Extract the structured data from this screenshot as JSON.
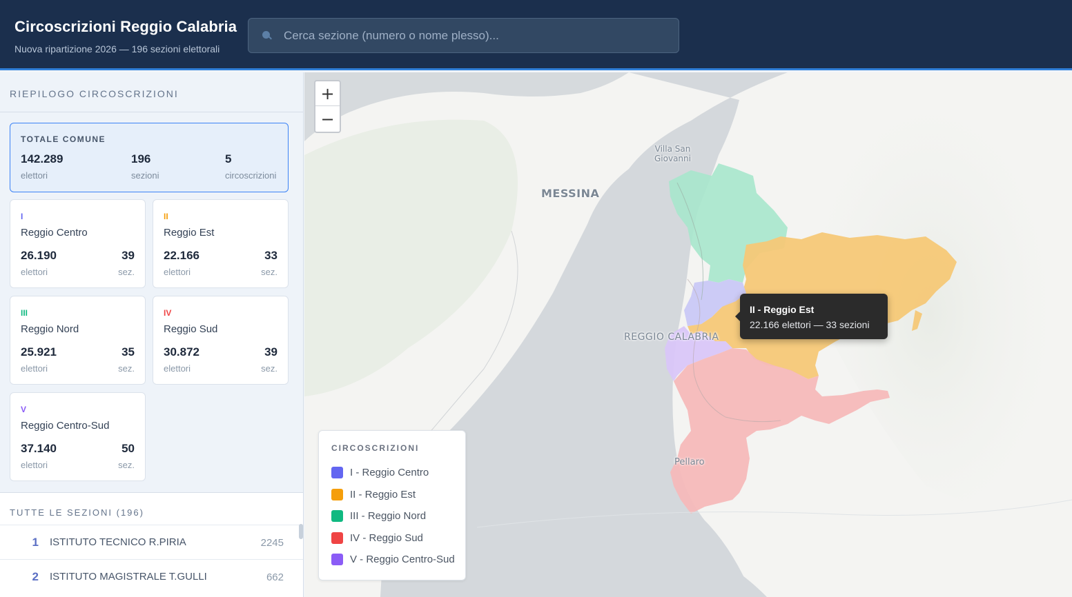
{
  "header": {
    "title": "Circoscrizioni Reggio Calabria",
    "subtitle": "Nuova ripartizione 2026 — 196 sezioni elettorali",
    "search_placeholder": "Cerca sezione (numero o nome plesso)..."
  },
  "sidebar": {
    "summary_heading": "RIEPILOGO CIRCOSCRIZIONI",
    "total": {
      "label": "TOTALE COMUNE",
      "elettori": "142.289",
      "elettori_label": "elettori",
      "sezioni": "196",
      "sezioni_label": "sezioni",
      "circoscrizioni": "5",
      "circoscrizioni_label": "circoscrizioni"
    },
    "circoscrizioni": [
      {
        "roman": "I",
        "name": "Reggio Centro",
        "elettori": "26.190",
        "sezioni": "39",
        "elettori_label": "elettori",
        "sez_label": "sez.",
        "color": "#6366f1"
      },
      {
        "roman": "II",
        "name": "Reggio Est",
        "elettori": "22.166",
        "sezioni": "33",
        "elettori_label": "elettori",
        "sez_label": "sez.",
        "color": "#f59e0b"
      },
      {
        "roman": "III",
        "name": "Reggio Nord",
        "elettori": "25.921",
        "sezioni": "35",
        "elettori_label": "elettori",
        "sez_label": "sez.",
        "color": "#10b981"
      },
      {
        "roman": "IV",
        "name": "Reggio Sud",
        "elettori": "30.872",
        "sezioni": "39",
        "elettori_label": "elettori",
        "sez_label": "sez.",
        "color": "#ef4444"
      },
      {
        "roman": "V",
        "name": "Reggio Centro-Sud",
        "elettori": "37.140",
        "sezioni": "50",
        "elettori_label": "elettori",
        "sez_label": "sez.",
        "color": "#8b5cf6"
      }
    ],
    "sections_heading": "TUTTE LE SEZIONI (196)",
    "sections": [
      {
        "num": "1",
        "name": "ISTITUTO TECNICO R.PIRIA",
        "count": "2245"
      },
      {
        "num": "2",
        "name": "ISTITUTO MAGISTRALE T.GULLI",
        "count": "662"
      }
    ]
  },
  "map": {
    "zoom_in": "+",
    "zoom_out": "−",
    "places": {
      "messina": "MESSINA",
      "villa1": "Villa San",
      "villa2": "Giovanni",
      "reggio": "REGGIO CALABRIA",
      "pellaro": "Pellaro"
    },
    "tooltip": {
      "title": "II - Reggio Est",
      "info": "22.166 elettori — 33 sezioni"
    },
    "legend": {
      "title": "CIRCOSCRIZIONI",
      "items": [
        {
          "label": "I - Reggio Centro",
          "color": "#6366f1"
        },
        {
          "label": "II - Reggio Est",
          "color": "#f59e0b"
        },
        {
          "label": "III - Reggio Nord",
          "color": "#10b981"
        },
        {
          "label": "IV - Reggio Sud",
          "color": "#ef4444"
        },
        {
          "label": "V - Reggio Centro-Sud",
          "color": "#8b5cf6"
        }
      ]
    }
  }
}
